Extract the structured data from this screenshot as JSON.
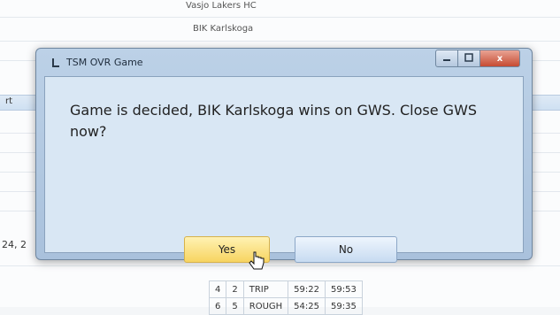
{
  "background": {
    "header_lines": [
      "Vasjo Lakers HC",
      "BIK Karlskoga"
    ],
    "bar_label": "rt",
    "left_cell": "24, 2",
    "table_rows": [
      [
        "4",
        "2",
        "TRIP",
        "59:22",
        "59:53"
      ],
      [
        "6",
        "5",
        "ROUGH",
        "54:25",
        "59:35"
      ]
    ]
  },
  "dialog": {
    "title": "TSM OVR Game",
    "close_glyph": "x",
    "message": "Game is decided, BIK Karlskoga wins on GWS. Close GWS now?",
    "yes_label": "Yes",
    "no_label": "No"
  }
}
